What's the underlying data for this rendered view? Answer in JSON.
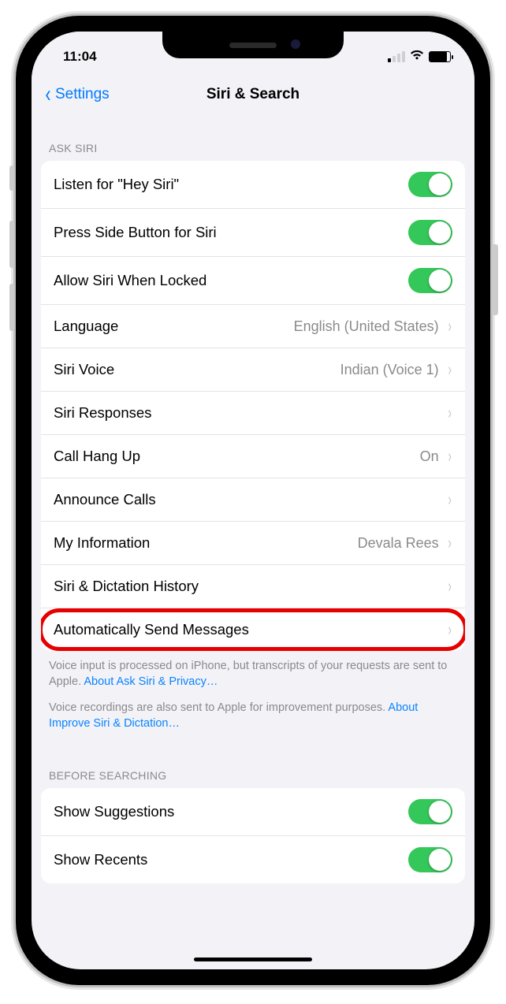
{
  "status": {
    "time": "11:04"
  },
  "nav": {
    "back_label": "Settings",
    "title": "Siri & Search"
  },
  "ask_siri": {
    "header": "ASK SIRI",
    "rows": {
      "hey_siri": "Listen for \"Hey Siri\"",
      "press_side": "Press Side Button for Siri",
      "allow_locked": "Allow Siri When Locked",
      "language_label": "Language",
      "language_value": "English (United States)",
      "voice_label": "Siri Voice",
      "voice_value": "Indian (Voice 1)",
      "responses": "Siri Responses",
      "hangup_label": "Call Hang Up",
      "hangup_value": "On",
      "announce": "Announce Calls",
      "myinfo_label": "My Information",
      "myinfo_value": "Devala Rees",
      "history": "Siri & Dictation History",
      "auto_send": "Automatically Send Messages"
    },
    "footer1_a": "Voice input is processed on iPhone, but transcripts of your requests are sent to Apple. ",
    "footer1_link": "About Ask Siri & Privacy…",
    "footer2_a": "Voice recordings are also sent to Apple for improvement purposes. ",
    "footer2_link": "About Improve Siri & Dictation…"
  },
  "before_searching": {
    "header": "BEFORE SEARCHING",
    "show_sugg": "Show Suggestions",
    "show_recents": "Show Recents"
  }
}
